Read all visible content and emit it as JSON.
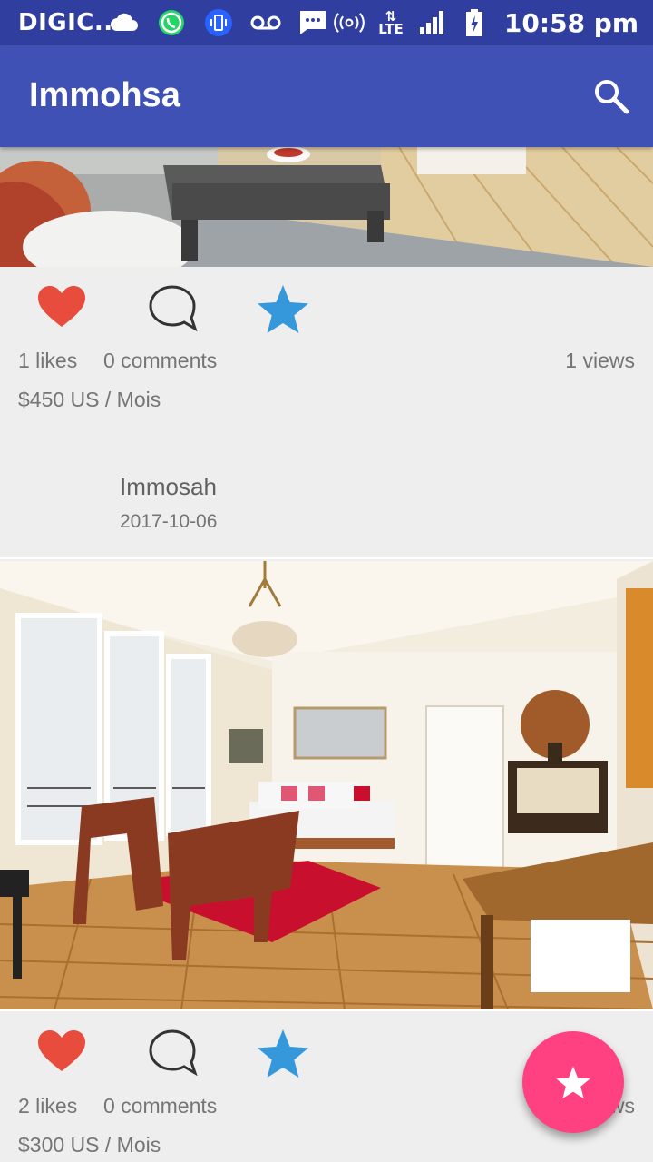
{
  "status_bar": {
    "carrier": "DIGIC..",
    "time": "10:58 pm",
    "network": "LTE",
    "icons": [
      "cloud-icon",
      "whatsapp-icon",
      "vibrate-icon",
      "voicemail-icon",
      "message-icon",
      "hotspot-icon",
      "lte-icon",
      "signal-icon",
      "battery-icon"
    ]
  },
  "toolbar": {
    "title": "Immohsa",
    "search_icon": "search-icon"
  },
  "posts": [
    {
      "likes": "1 likes",
      "comments": "0 comments",
      "views": "1 views",
      "price": "$450 US / Mois",
      "author": "Immosah",
      "date": "2017-10-06"
    },
    {
      "likes": "2 likes",
      "comments": "0 comments",
      "views": "2 views",
      "price": "$300 US / Mois"
    }
  ],
  "colors": {
    "primary": "#3f51b5",
    "primary_dark": "#303f9f",
    "accent": "#ff4081",
    "like": "#e74c3c",
    "star": "#3498db"
  },
  "fab": {
    "icon": "star-icon"
  }
}
